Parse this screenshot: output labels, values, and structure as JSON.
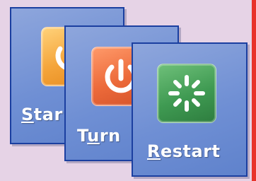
{
  "buttons": {
    "standby": {
      "label_underlined": "S",
      "label_rest": "tar",
      "icon": "standby-icon",
      "color": "#f4a43a"
    },
    "turnoff": {
      "label_first": "T",
      "label_underlined": "u",
      "label_rest": "rn",
      "icon": "power-icon",
      "color": "#ec6a3a"
    },
    "restart": {
      "label_underlined": "R",
      "label_rest": "estart",
      "icon": "restart-icon",
      "color": "#3f9a52"
    }
  },
  "colors": {
    "background": "#e6d3e6",
    "card": "#7594d6",
    "card_border": "#1b3fa0",
    "accent_red": "#e8322a"
  }
}
